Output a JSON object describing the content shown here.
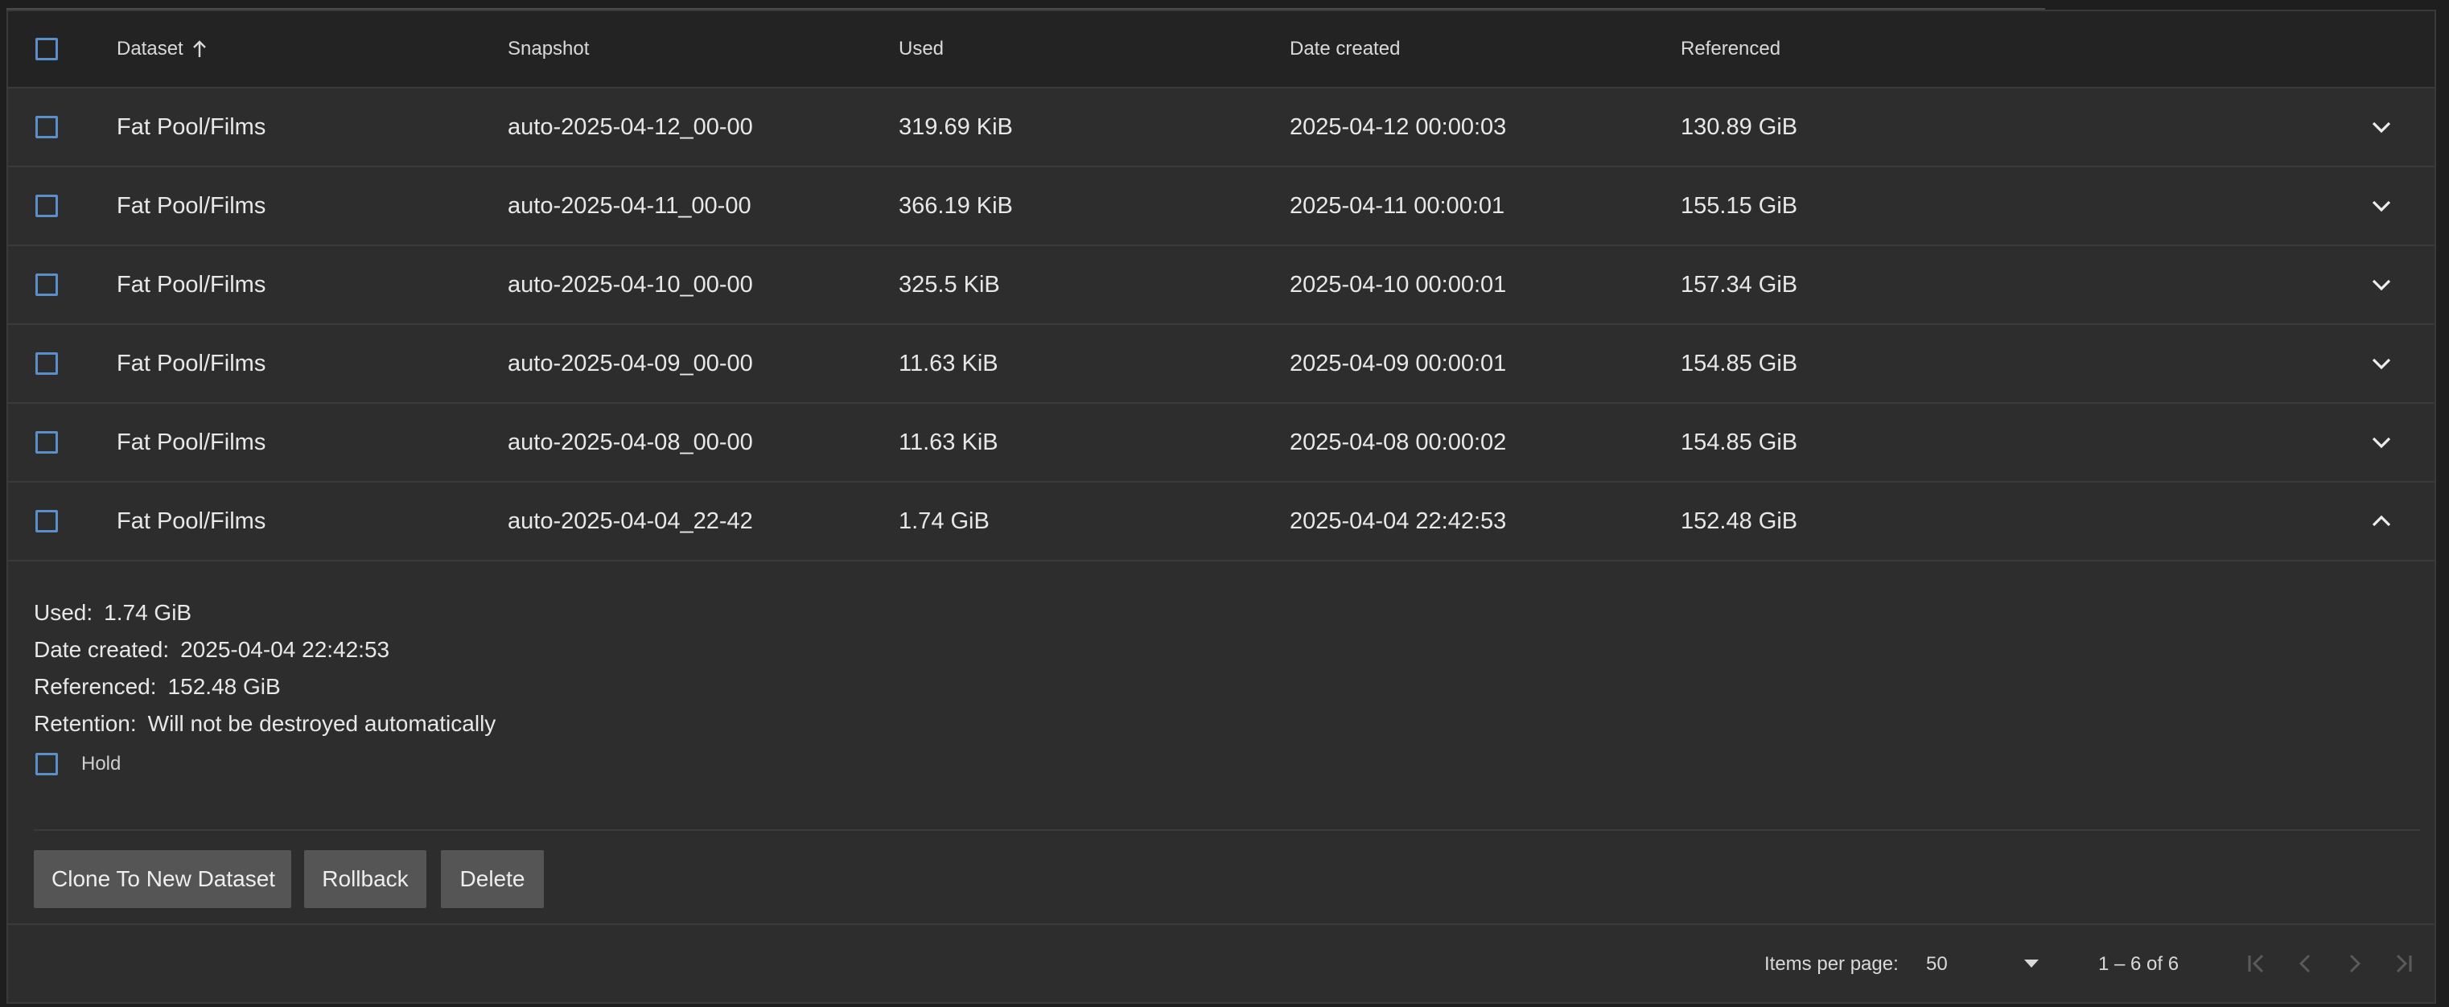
{
  "table": {
    "columns": {
      "dataset": "Dataset",
      "snapshot": "Snapshot",
      "used": "Used",
      "date_created": "Date created",
      "referenced": "Referenced"
    },
    "sort": "ascending",
    "rows": [
      {
        "dataset": "Fat Pool/Films",
        "snapshot": "auto-2025-04-12_00-00",
        "used": "319.69 KiB",
        "date_created": "2025-04-12 00:00:03",
        "referenced": "130.89 GiB",
        "expanded": false
      },
      {
        "dataset": "Fat Pool/Films",
        "snapshot": "auto-2025-04-11_00-00",
        "used": "366.19 KiB",
        "date_created": "2025-04-11 00:00:01",
        "referenced": "155.15 GiB",
        "expanded": false
      },
      {
        "dataset": "Fat Pool/Films",
        "snapshot": "auto-2025-04-10_00-00",
        "used": "325.5 KiB",
        "date_created": "2025-04-10 00:00:01",
        "referenced": "157.34 GiB",
        "expanded": false
      },
      {
        "dataset": "Fat Pool/Films",
        "snapshot": "auto-2025-04-09_00-00",
        "used": "11.63 KiB",
        "date_created": "2025-04-09 00:00:01",
        "referenced": "154.85 GiB",
        "expanded": false
      },
      {
        "dataset": "Fat Pool/Films",
        "snapshot": "auto-2025-04-08_00-00",
        "used": "11.63 KiB",
        "date_created": "2025-04-08 00:00:02",
        "referenced": "154.85 GiB",
        "expanded": false
      },
      {
        "dataset": "Fat Pool/Films",
        "snapshot": "auto-2025-04-04_22-42",
        "used": "1.74 GiB",
        "date_created": "2025-04-04 22:42:53",
        "referenced": "152.48 GiB",
        "expanded": true
      }
    ]
  },
  "details": {
    "used_label": "Used:",
    "used_value": "1.74 GiB",
    "date_label": "Date created:",
    "date_value": "2025-04-04 22:42:53",
    "referenced_label": "Referenced:",
    "referenced_value": "152.48 GiB",
    "retention_label": "Retention:",
    "retention_value": "Will not be destroyed automatically",
    "hold_label": "Hold",
    "hold_checked": false,
    "buttons": {
      "clone": "Clone To New Dataset",
      "rollback": "Rollback",
      "delete": "Delete"
    }
  },
  "paginator": {
    "items_per_page_label": "Items per page:",
    "items_per_page_value": "50",
    "range_label": "1 – 6 of 6"
  },
  "icons": {
    "sort": "arrow-up-icon",
    "expand": "chevron-down-icon",
    "collapse": "chevron-up-icon",
    "first_page": "first-page-icon",
    "prev_page": "chevron-left-icon",
    "next_page": "chevron-right-icon",
    "last_page": "last-page-icon",
    "dropdown": "caret-down-icon"
  },
  "colors": {
    "background": "#2d2d2d",
    "header_background": "#232323",
    "checkbox_border": "#5b8fc9",
    "button_background": "#555555",
    "text": "#e8e8e8"
  }
}
